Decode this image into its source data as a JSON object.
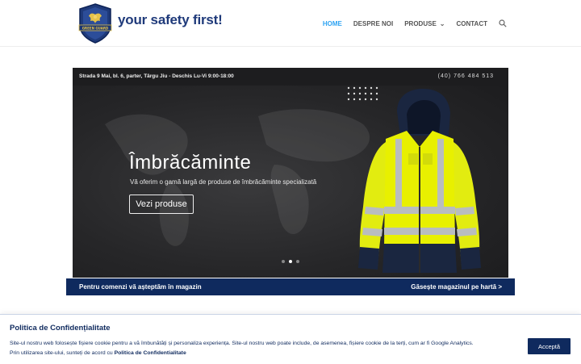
{
  "header": {
    "tagline": "your safety first!",
    "logo_text": "GREEN GUARD",
    "nav": [
      {
        "label": "HOME",
        "active": true,
        "dropdown": false
      },
      {
        "label": "DESPRE NOI",
        "active": false,
        "dropdown": false
      },
      {
        "label": "PRODUSE",
        "active": false,
        "dropdown": true
      },
      {
        "label": "CONTACT",
        "active": false,
        "dropdown": false
      }
    ],
    "search_icon": "search-icon"
  },
  "hero": {
    "address": "Strada 9 Mai, bl. 6, parter, Târgu Jiu - Deschis Lu-Vi 9:00-18:00",
    "phone": "(40) 766 484 513",
    "title": "Îmbrăcăminte",
    "subtitle": "Vă oferim o gamă largă de produse de îmbrăcăminte specializată",
    "button_label": "Vezi produse",
    "slide_count": 3,
    "active_slide": 2
  },
  "bluebar": {
    "left_text": "Pentru comenzi vă așteptăm în magazin",
    "right_text": "Găsește magazinul pe hartă >"
  },
  "cookie": {
    "title": "Politica de Confidențialitate",
    "text_1": "Site-ul nostru web folosește fișiere cookie pentru a vă îmbunătăți și personaliza experiența. Site-ul nostru web poate include, de asemenea, fișiere cookie de la terți, cum ar fi Google Analytics.",
    "text_2": "Prin utilizarea site-ului, sunteți de acord cu ",
    "link": "Politica de Confidentialitate",
    "accept_label": "Acceptă"
  },
  "colors": {
    "brand_navy": "#0f2a5e",
    "nav_active": "#2ea3f2",
    "hivis_yellow": "#e8f000"
  }
}
